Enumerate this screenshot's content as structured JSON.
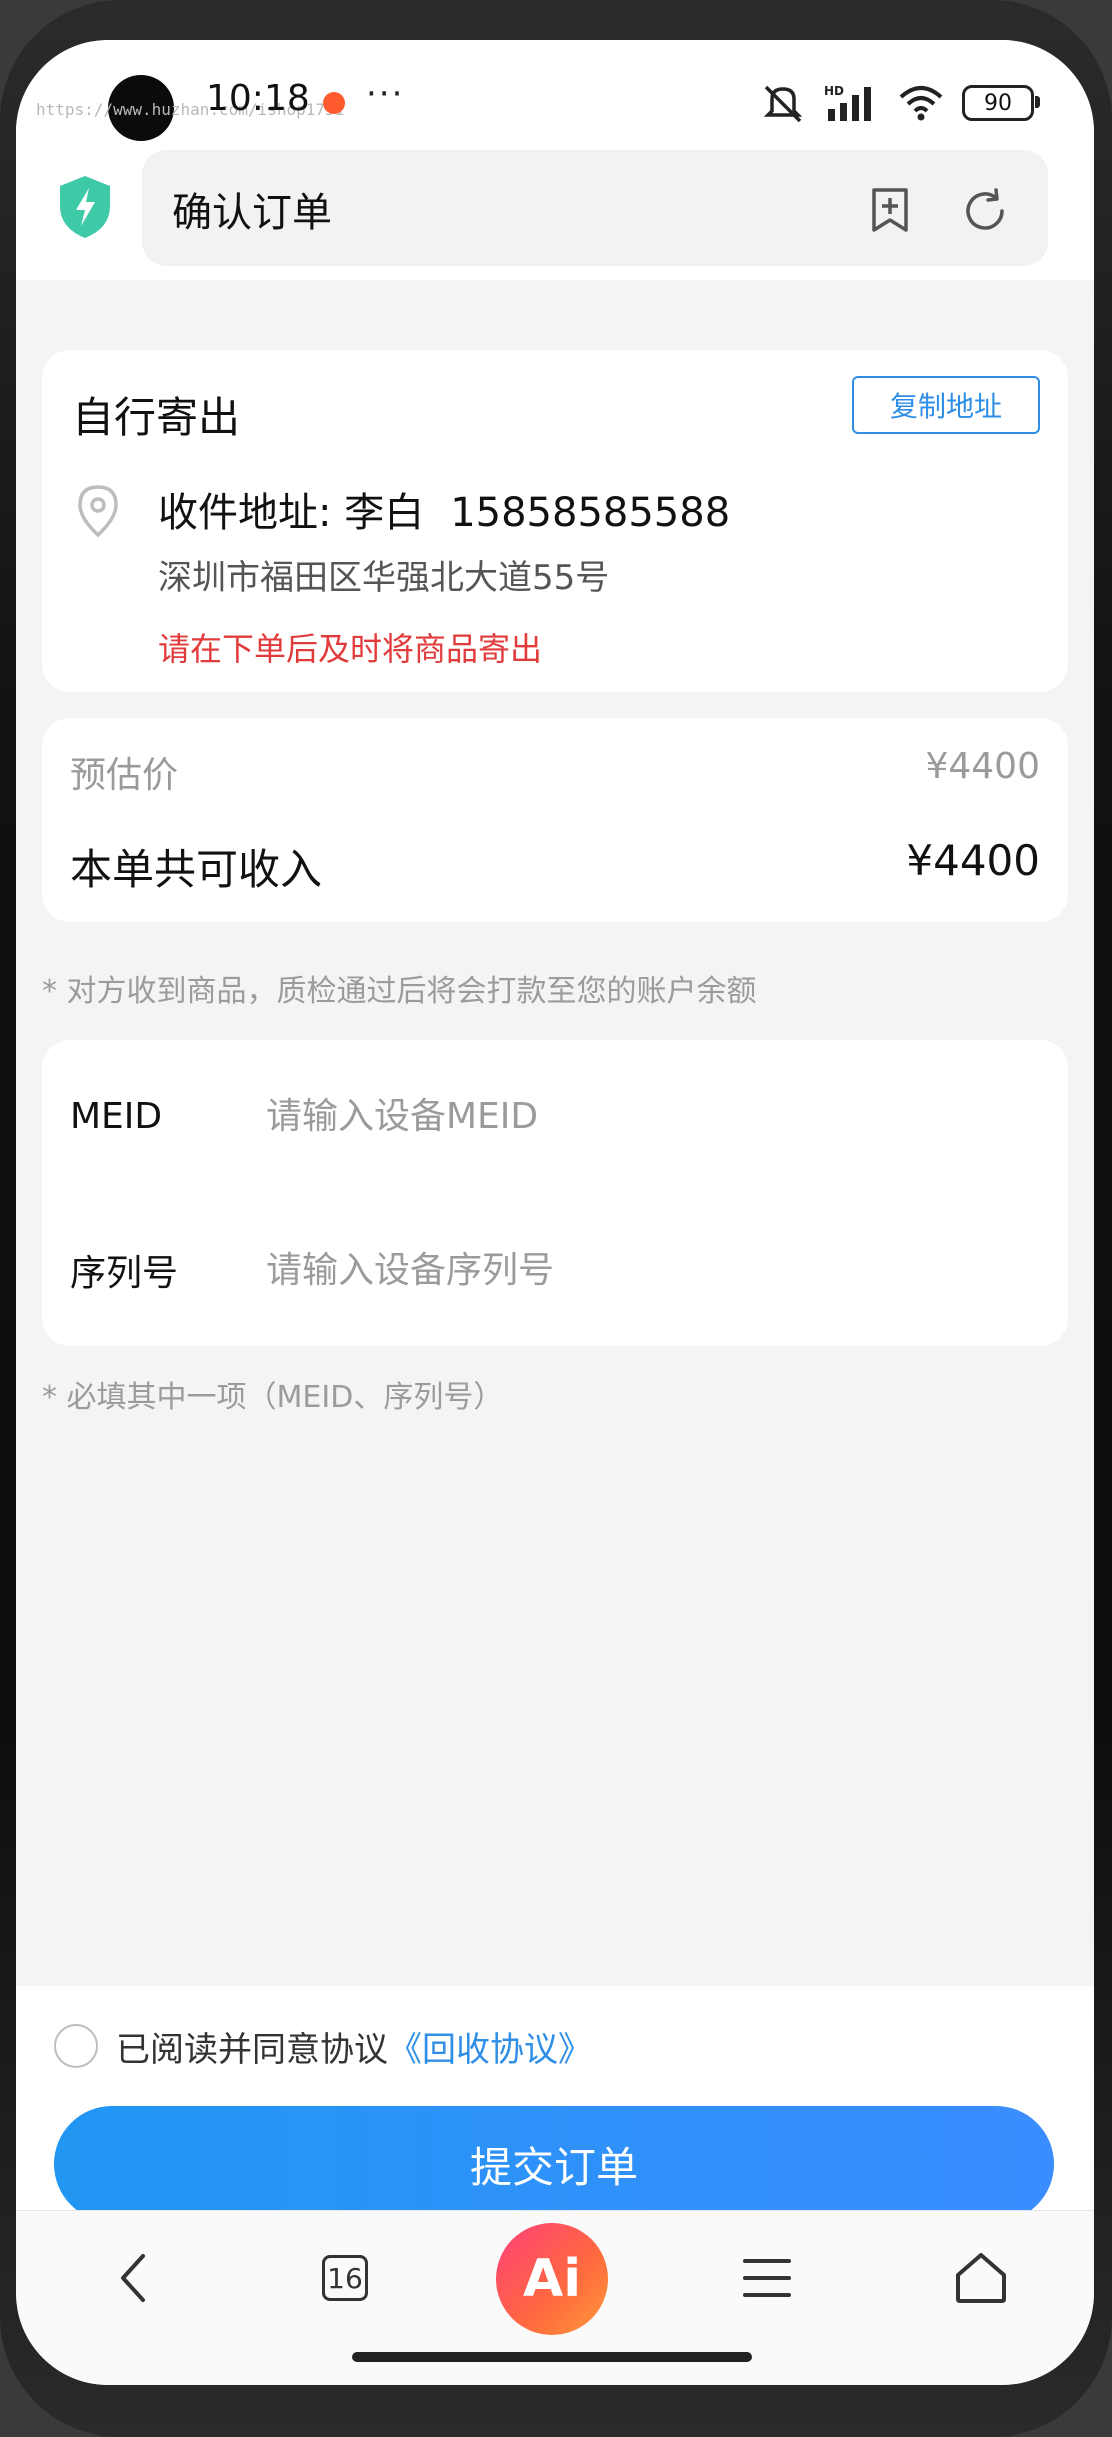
{
  "status_bar": {
    "time": "10:18",
    "watermark": "https://www.huzhan.com/ishop1751",
    "more": "···",
    "battery": "90",
    "network_hd": "HD"
  },
  "browser": {
    "page_title": "确认订单"
  },
  "shipping": {
    "title": "自行寄出",
    "copy_button": "复制地址",
    "receiver_prefix": "收件地址: 李白",
    "receiver_phone": "15858585588",
    "address": "深圳市福田区华强北大道55号",
    "warning": "请在下单后及时将商品寄出"
  },
  "price": {
    "estimate_label": "预估价",
    "estimate_value": "¥4400",
    "total_label": "本单共可收入",
    "total_value": "¥4400"
  },
  "notes": {
    "payment": "* 对方收到商品，质检通过后将会打款至您的账户余额",
    "required": "* 必填其中一项（MEID、序列号）"
  },
  "form": {
    "meid_label": "MEID",
    "meid_placeholder": "请输入设备MEID",
    "meid_value": "",
    "serial_label": "序列号",
    "serial_placeholder": "请输入设备序列号",
    "serial_value": ""
  },
  "agreement": {
    "text": "已阅读并同意协议",
    "link": "《回收协议》",
    "checked": false
  },
  "submit_button": "提交订单",
  "nav": {
    "tab_count": "16",
    "ai_label": "Ai"
  },
  "colors": {
    "accent": "#2f8fe6",
    "warning": "#e23b3b",
    "shield": "#3ec9a7"
  }
}
